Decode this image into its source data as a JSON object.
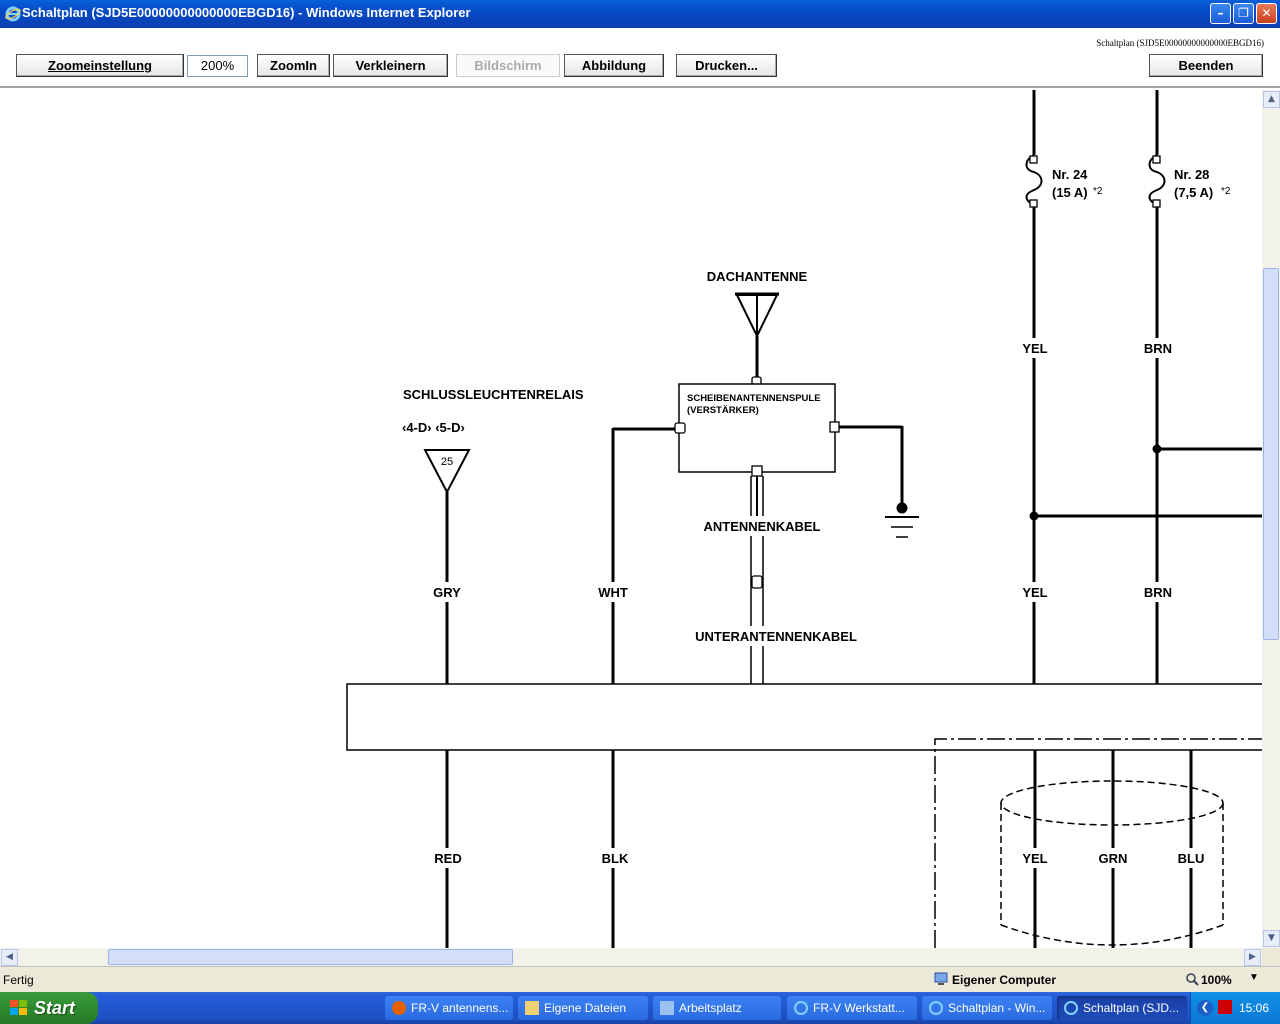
{
  "window": {
    "title": "Schaltplan (SJD5E00000000000000EBGD16) - Windows Internet Explorer",
    "doc_id": "Schaltplan (SJD5E00000000000000EBGD16)"
  },
  "toolbar": {
    "zoom_setting": "Zoomeinstellung",
    "zoom_value": "200%",
    "zoom_in": "ZoomIn",
    "zoom_out": "Verkleinern",
    "screen": "Bildschirm",
    "figure": "Abbildung",
    "print": "Drucken...",
    "exit": "Beenden"
  },
  "diagram": {
    "dachantenne": "DACHANTENNE",
    "amp_line1": "SCHEIBENANTENNENSPULE",
    "amp_line2": "(VERSTÄRKER)",
    "schluss": "SCHLUSSLEUCHTENRELAIS",
    "relay_codes": "‹4-D› ‹5-D›",
    "relay_num": "25",
    "antennenkabel": "ANTENNENKABEL",
    "unterantennenkabel": "UNTERANTENNENKABEL",
    "fuse24_name": "Nr. 24",
    "fuse24_rating": "(15 A)",
    "fuse28_name": "Nr. 28",
    "fuse28_rating": "(7,5 A)",
    "footnote": "*2",
    "wire_gry": "GRY",
    "wire_wht": "WHT",
    "wire_yel": "YEL",
    "wire_brn": "BRN",
    "wire_red": "RED",
    "wire_blk": "BLK",
    "wire_grn": "GRN",
    "wire_blu": "BLU"
  },
  "status": {
    "text": "Fertig",
    "zone": "Eigener Computer",
    "zoom": "100%"
  },
  "taskbar": {
    "start": "Start",
    "tasks": [
      "FR-V antennens...",
      "Eigene Dateien",
      "Arbeitsplatz",
      "FR-V Werkstatt...",
      "Schaltplan - Win...",
      "Schaltplan (SJD..."
    ],
    "clock": "15:06"
  }
}
